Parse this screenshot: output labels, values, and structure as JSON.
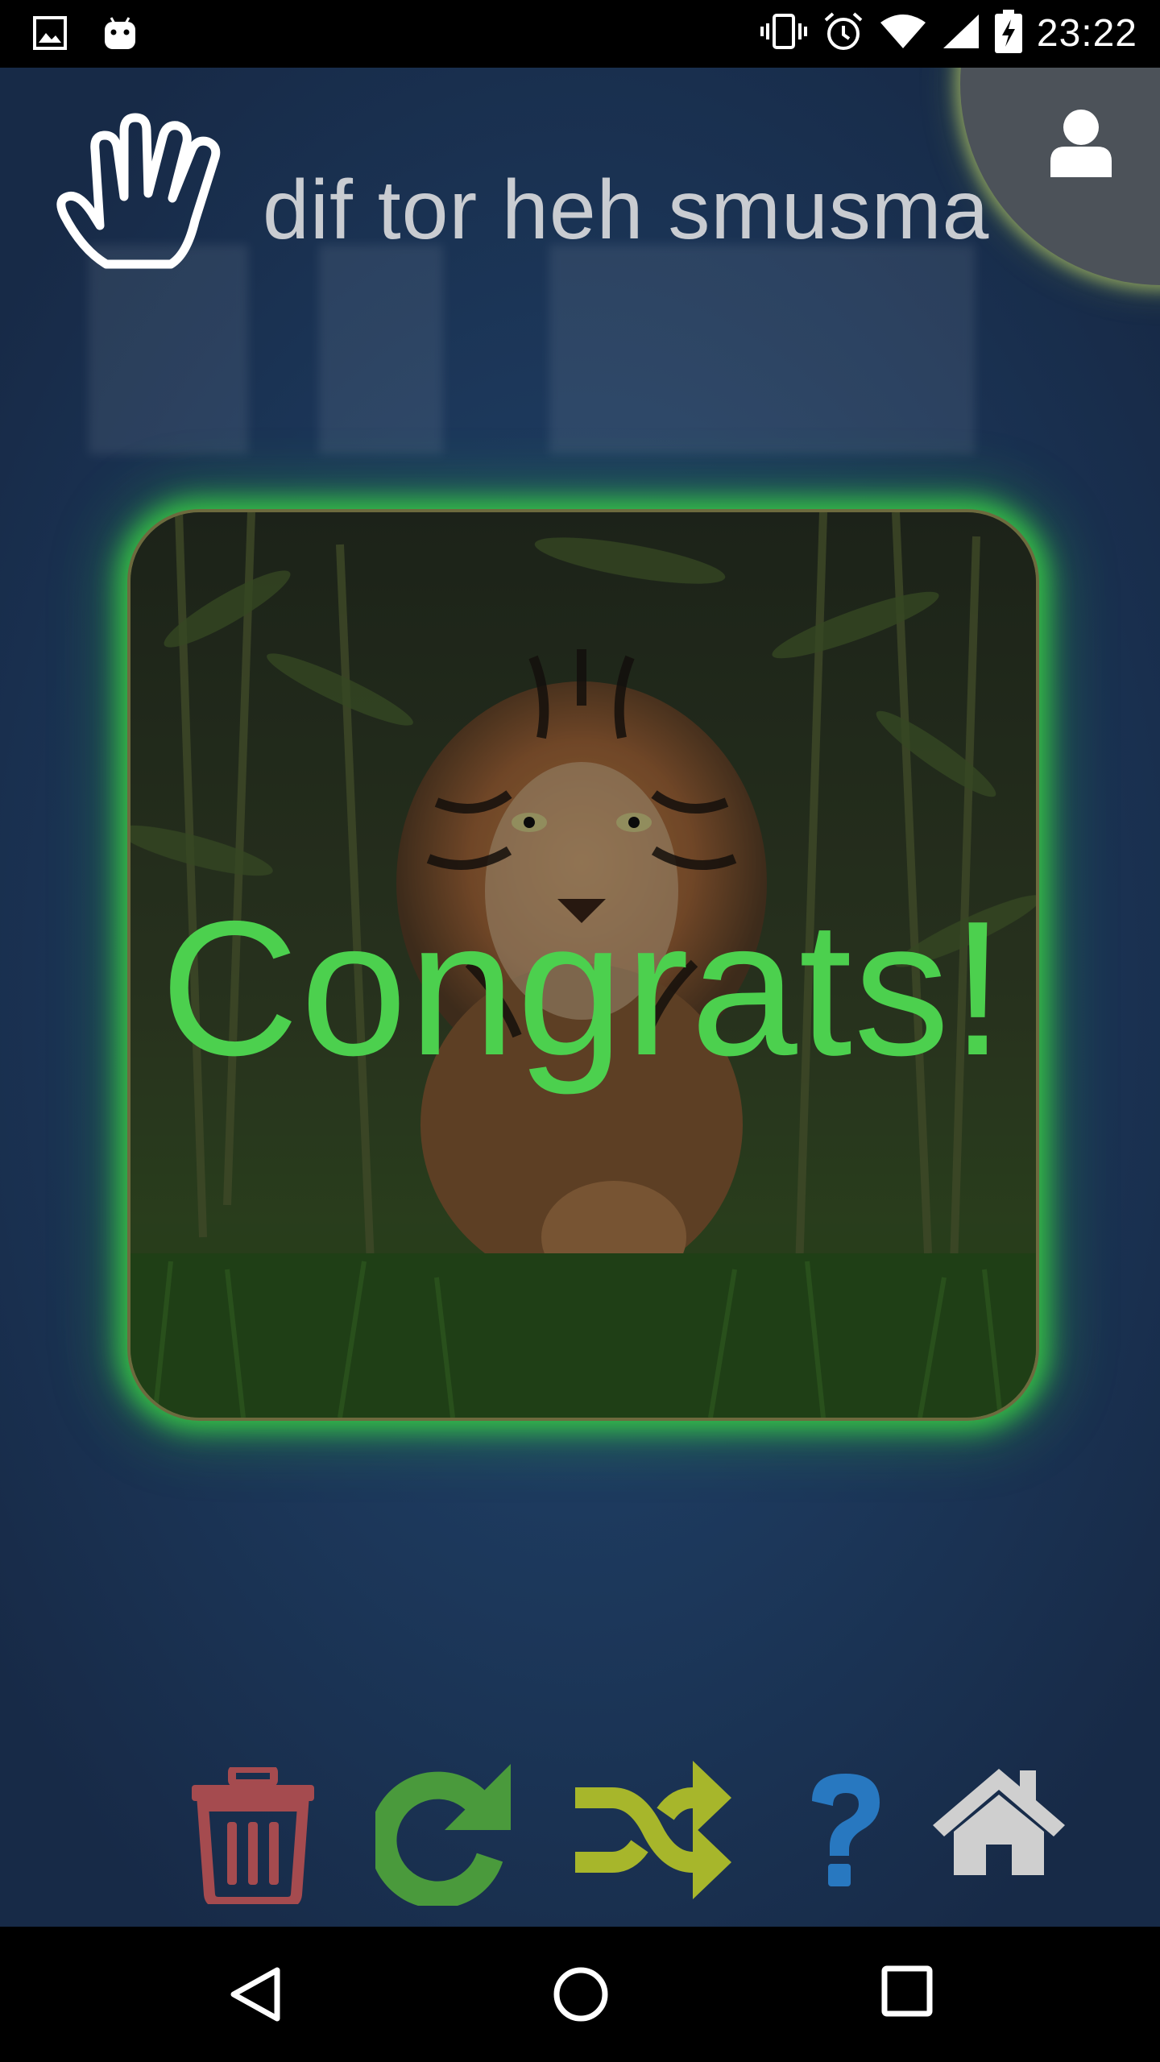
{
  "status_bar": {
    "time": "23:22",
    "left_icons": [
      "image-notification-icon",
      "android-notification-icon"
    ],
    "right_icons": [
      "vibrate-icon",
      "alarm-icon",
      "wifi-icon",
      "cellular-signal-icon",
      "battery-charging-icon"
    ]
  },
  "header": {
    "title": "dif tor heh smusma",
    "logo_icon": "vulcan-salute-hand-icon",
    "profile_icon": "user-icon"
  },
  "card": {
    "message": "Congrats!",
    "image": "tiger-in-bamboo-photo",
    "glow_color": "#3fd84a"
  },
  "toolbar": {
    "buttons": [
      {
        "name": "delete",
        "icon": "trash-icon",
        "color": "#a54b4f"
      },
      {
        "name": "redo",
        "icon": "redo-arrow-icon",
        "color": "#4a9a3c"
      },
      {
        "name": "shuffle",
        "icon": "shuffle-icon",
        "color": "#a7b62b"
      },
      {
        "name": "help",
        "icon": "question-icon",
        "color": "#2878c0"
      },
      {
        "name": "home",
        "icon": "home-icon",
        "color": "#cfcfcf"
      }
    ]
  },
  "nav_bar": {
    "buttons": [
      "back-icon",
      "home-circle-icon",
      "recents-icon"
    ]
  }
}
